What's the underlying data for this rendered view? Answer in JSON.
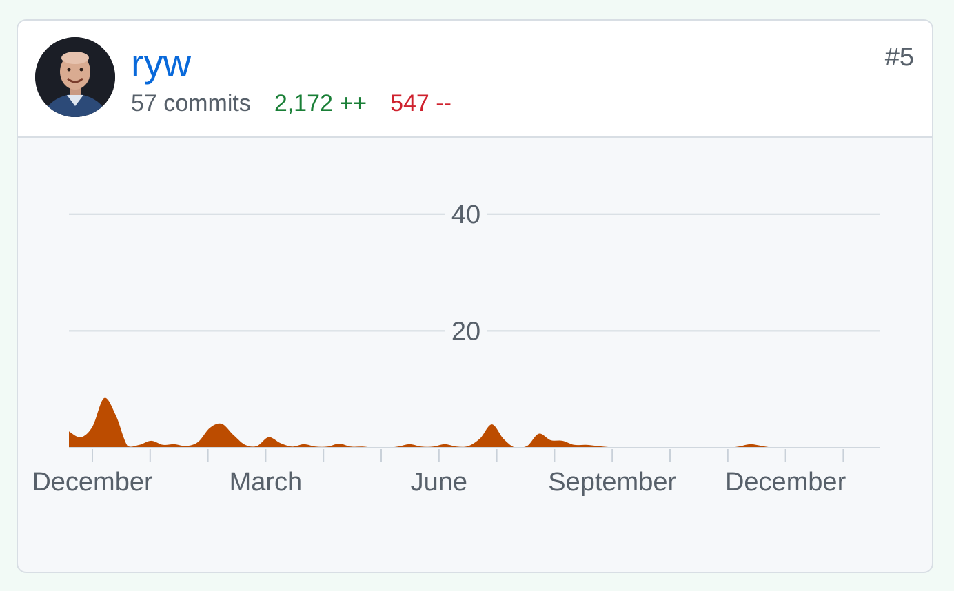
{
  "contributor": {
    "username": "ryw",
    "avatar_alt": "ryw",
    "commits_text": "57 commits",
    "additions_text": "2,172 ++",
    "deletions_text": "547 --",
    "rank": "#5"
  },
  "colors": {
    "link": "#0969da",
    "additions": "#1a7f37",
    "deletions": "#cf222e",
    "area_fill": "#bc4c00",
    "muted_text": "#57606a"
  },
  "chart_data": {
    "type": "area",
    "title": "",
    "xlabel": "",
    "ylabel": "",
    "ylim": [
      0,
      50
    ],
    "y_ticks": [
      20,
      40
    ],
    "grid": true,
    "x_tick_labels": [
      "December",
      "March",
      "June",
      "September",
      "December"
    ],
    "series": [
      {
        "values": [
          2.8,
          1.8,
          3.6,
          8.5,
          5.5,
          0.3,
          0.5,
          1.2,
          0.5,
          0.6,
          0.3,
          1.0,
          3.4,
          4.1,
          2.2,
          0.5,
          0.3,
          1.8,
          0.8,
          0.2,
          0.6,
          0.2,
          0.2,
          0.7,
          0.2,
          0.2,
          0,
          0,
          0.2,
          0.6,
          0.2,
          0.2,
          0.6,
          0.2,
          0.3,
          1.6,
          4.0,
          1.5,
          0,
          0.3,
          2.4,
          1.3,
          1.2,
          0.5,
          0.5,
          0.3,
          0.1,
          0,
          0,
          0,
          0,
          0,
          0,
          0,
          0,
          0,
          0,
          0.2,
          0.6,
          0.3,
          0,
          0,
          0,
          0,
          0,
          0,
          0,
          0,
          0,
          0
        ]
      }
    ]
  }
}
